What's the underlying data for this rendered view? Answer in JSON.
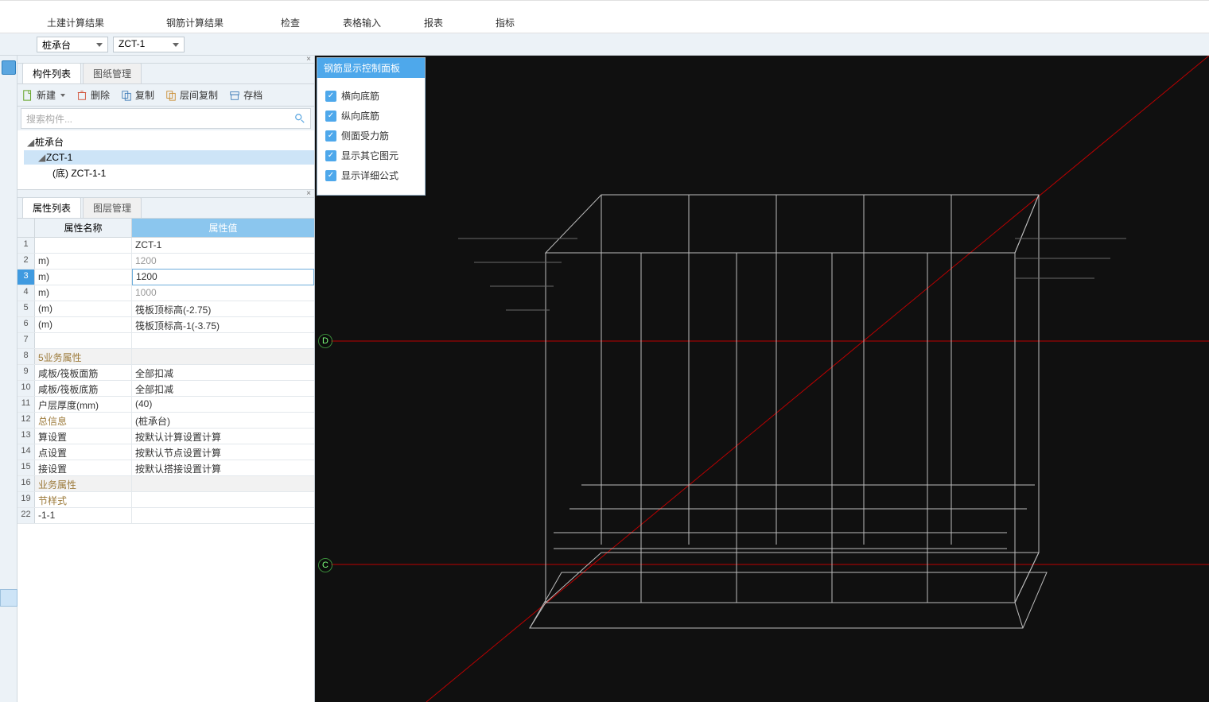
{
  "ribbon": {
    "groups": [
      "土建计算结果",
      "钢筋计算结果",
      "检查",
      "表格输入",
      "报表",
      "指标"
    ]
  },
  "breadcrumb": {
    "level1": "桩承台",
    "level2": "ZCT-1"
  },
  "componentPanel": {
    "tabs": {
      "list": "构件列表",
      "drawings": "图纸管理"
    },
    "toolbar": {
      "new": "新建",
      "delete": "删除",
      "copy": "复制",
      "layerCopy": "层间复制",
      "archive": "存档"
    },
    "searchPlaceholder": "搜索构件...",
    "tree": {
      "root": "桩承台",
      "child1": "ZCT-1",
      "child2": "(底)  ZCT-1-1"
    }
  },
  "propsPanel": {
    "tabs": {
      "props": "属性列表",
      "layers": "图层管理"
    },
    "header": {
      "name": "属性名称",
      "value": "属性值"
    },
    "rows": [
      {
        "n": "1",
        "k": "",
        "v": "ZCT-1"
      },
      {
        "n": "2",
        "k": "m)",
        "v": "1200",
        "gray": true
      },
      {
        "n": "3",
        "k": "m)",
        "v": "1200",
        "selected": true
      },
      {
        "n": "4",
        "k": "m)",
        "v": "1000",
        "gray": true
      },
      {
        "n": "5",
        "k": "(m)",
        "v": "筏板顶标高(-2.75)"
      },
      {
        "n": "6",
        "k": "(m)",
        "v": "筏板顶标高-1(-3.75)"
      },
      {
        "n": "7",
        "k": "",
        "v": ""
      },
      {
        "n": "8",
        "k": "5业务属性",
        "v": "",
        "section": true,
        "brown": true
      },
      {
        "n": "9",
        "k": "咸板/筏板面筋",
        "v": "全部扣减"
      },
      {
        "n": "10",
        "k": "咸板/筏板底筋",
        "v": "全部扣减"
      },
      {
        "n": "11",
        "k": "户层厚度(mm)",
        "v": "(40)"
      },
      {
        "n": "12",
        "k": "总信息",
        "v": "(桩承台)",
        "brown": true
      },
      {
        "n": "13",
        "k": "算设置",
        "v": "按默认计算设置计算"
      },
      {
        "n": "14",
        "k": "点设置",
        "v": "按默认节点设置计算"
      },
      {
        "n": "15",
        "k": "接设置",
        "v": "按默认搭接设置计算"
      },
      {
        "n": "16",
        "k": "业务属性",
        "v": "",
        "section": true,
        "brown": true
      },
      {
        "n": "19",
        "k": "节样式",
        "v": "",
        "brown": true
      },
      {
        "n": "22",
        "k": "-1-1",
        "v": ""
      }
    ]
  },
  "floatPanel": {
    "title": "钢筋显示控制面板",
    "items": [
      "横向底筋",
      "纵向底筋",
      "侧面受力筋",
      "显示其它图元",
      "显示详细公式"
    ]
  },
  "axes": {
    "d": "D",
    "c": "C"
  }
}
